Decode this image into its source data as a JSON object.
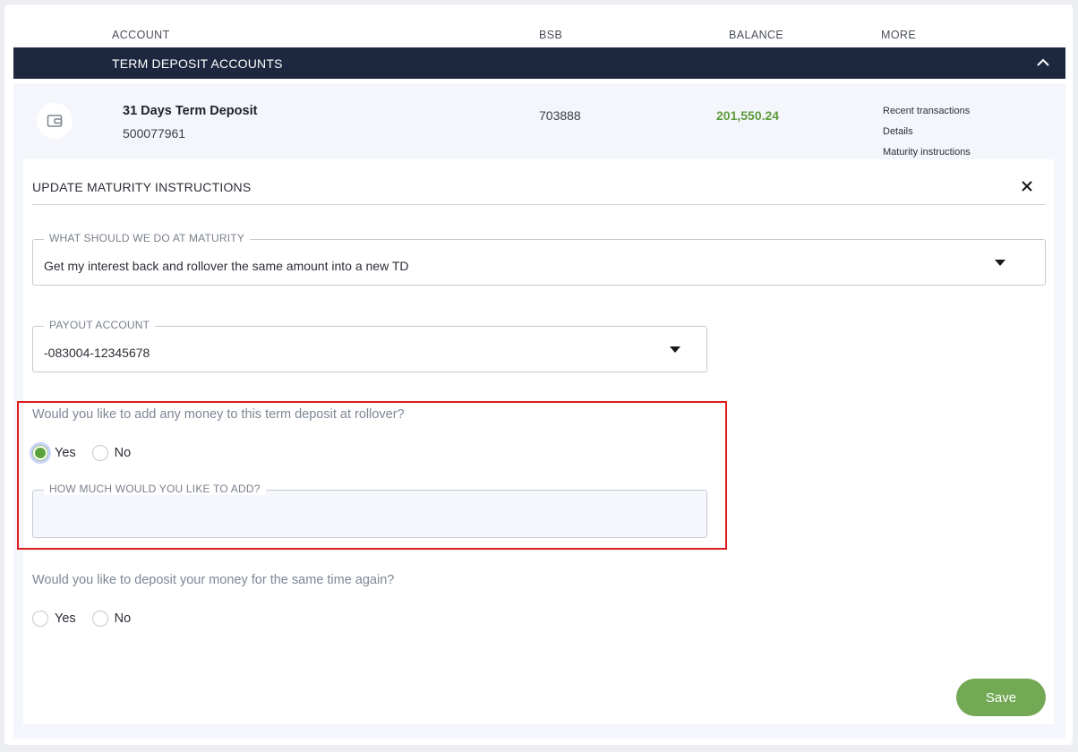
{
  "table": {
    "columns": {
      "account": "ACCOUNT",
      "bsb": "BSB",
      "balance": "BALANCE",
      "more": "MORE"
    },
    "section_title": "TERM DEPOSIT ACCOUNTS",
    "section_toggle_icon": "chevron-up-icon"
  },
  "account": {
    "icon": "wallet-icon",
    "name": "31 Days Term Deposit",
    "number": "500077961",
    "bsb": "703888",
    "balance": "201,550.24",
    "balance_color": "#5c9b3c",
    "more_links": [
      "Recent transactions",
      "Details",
      "Maturity instructions"
    ]
  },
  "panel": {
    "title": "UPDATE MATURITY INSTRUCTIONS",
    "close_icon": "close-icon",
    "maturity_select": {
      "label": "WHAT SHOULD WE DO AT MATURITY",
      "value": "Get my interest back and rollover the same amount into a new TD"
    },
    "payout_select": {
      "label": "PAYOUT ACCOUNT",
      "value": "-083004-12345678"
    },
    "add_money": {
      "question": "Would you like to add any money to this term deposit at rollover?",
      "yes_label": "Yes",
      "no_label": "No",
      "selected": "Yes",
      "amount_label": "HOW MUCH WOULD YOU LIKE TO ADD?",
      "amount_value": ""
    },
    "same_term": {
      "question": "Would you like to deposit your money for the same time again?",
      "yes_label": "Yes",
      "no_label": "No",
      "selected": ""
    },
    "save_label": "Save",
    "save_color": "#73a955",
    "highlight_color": "#e01b1b"
  }
}
